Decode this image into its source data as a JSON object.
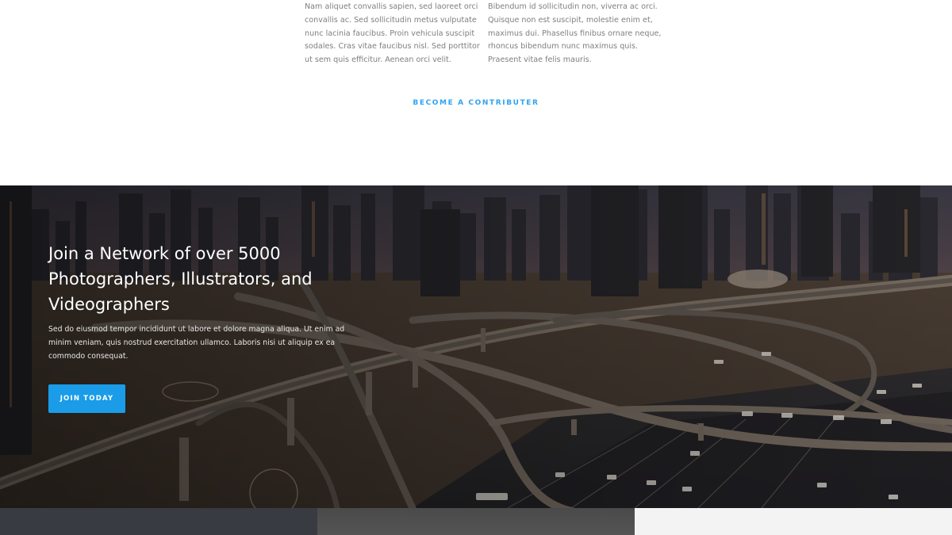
{
  "intro": {
    "left_lines": [
      "Nam aliquet convallis sapien, sed laoreet orci",
      "convallis ac. Sed sollicitudin metus vulputate",
      "nunc lacinia faucibus. Proin vehicula suscipit",
      "sodales. Cras vitae faucibus nisl. Sed porttitor",
      "ut sem quis efficitur. Aenean orci velit."
    ],
    "right_lines": [
      "Bibendum id sollicitudin non, viverra ac orci.",
      "Quisque non est suscipit, molestie enim et,",
      "maximus dui. Phasellus finibus ornare neque,",
      "rhoncus bibendum nunc maximus quis.",
      "Praesent vitae felis mauris."
    ],
    "contributor_link": "BECOME A CONTRIBUTER",
    "link_color": "#2ea3f2"
  },
  "hero": {
    "title_lines": [
      "Join a Network of over 5000",
      "Photographers, Illustrators, and",
      "Videographers"
    ],
    "description_lines": [
      "Sed do eiusmod tempor incididunt ut labore et dolore magna aliqua. Ut enim ad",
      "minim veniam, quis nostrud exercitation ullamco. Laboris nisi ut aliquip ex ea",
      "commodo consequat."
    ],
    "cta_label": "JOIN TODAY",
    "cta_color": "#1a9ce8",
    "background_image": "city-highway-interchange-photo"
  },
  "bottom_panels": [
    "dark-panel",
    "gray-panel",
    "light-panel"
  ]
}
